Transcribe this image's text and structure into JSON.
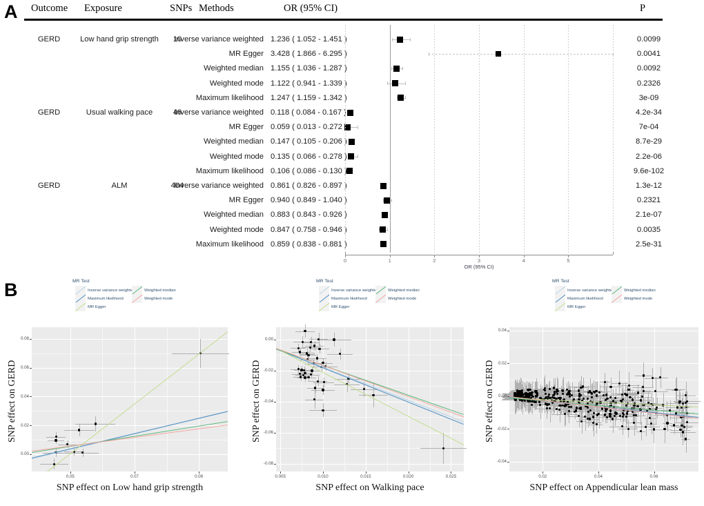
{
  "panels": {
    "a_letter": "A",
    "b_letter": "B"
  },
  "table": {
    "headers": {
      "outcome": "Outcome",
      "exposure": "Exposure",
      "snps": "SNPs",
      "methods": "Methods",
      "or": "OR (95% CI)",
      "p": "P"
    },
    "groups": [
      {
        "outcome": "GERD",
        "exposure": "Low hand grip strength",
        "snps": "10",
        "rows": [
          {
            "method": "Inverse variance weighted",
            "or_text": "1.236 ( 1.052 - 1.451 )",
            "est": 1.236,
            "lo": 1.052,
            "hi": 1.451,
            "p": "0.0099"
          },
          {
            "method": "MR Egger",
            "or_text": "3.428 ( 1.866 - 6.295 )",
            "est": 3.428,
            "lo": 1.866,
            "hi": 6.295,
            "p": "0.0041"
          },
          {
            "method": "Weighted median",
            "or_text": "1.155 ( 1.036 - 1.287 )",
            "est": 1.155,
            "lo": 1.036,
            "hi": 1.287,
            "p": "0.0092"
          },
          {
            "method": "Weighted mode",
            "or_text": "1.122 ( 0.941 - 1.339 )",
            "est": 1.122,
            "lo": 0.941,
            "hi": 1.339,
            "p": "0.2326"
          },
          {
            "method": "Maximum likelihood",
            "or_text": "1.247 ( 1.159 - 1.342 )",
            "est": 1.247,
            "lo": 1.159,
            "hi": 1.342,
            "p": "3e-09"
          }
        ]
      },
      {
        "outcome": "GERD",
        "exposure": "Usual walking pace",
        "snps": "46",
        "rows": [
          {
            "method": "Inverse variance weighted",
            "or_text": "0.118 ( 0.084 - 0.167 )",
            "est": 0.118,
            "lo": 0.084,
            "hi": 0.167,
            "p": "4.2e-34"
          },
          {
            "method": "MR Egger",
            "or_text": "0.059 ( 0.013 - 0.272 )",
            "est": 0.059,
            "lo": 0.013,
            "hi": 0.272,
            "p": "7e-04"
          },
          {
            "method": "Weighted median",
            "or_text": "0.147 ( 0.105 - 0.206 )",
            "est": 0.147,
            "lo": 0.105,
            "hi": 0.206,
            "p": "8.7e-29"
          },
          {
            "method": "Weighted mode",
            "or_text": "0.135 ( 0.066 - 0.278 )",
            "est": 0.135,
            "lo": 0.066,
            "hi": 0.278,
            "p": "2.2e-06"
          },
          {
            "method": "Maximum likelihood",
            "or_text": "0.106 ( 0.086 - 0.130 )",
            "est": 0.106,
            "lo": 0.086,
            "hi": 0.13,
            "p": "9.6e-102"
          }
        ]
      },
      {
        "outcome": "GERD",
        "exposure": "ALM",
        "snps": "404",
        "rows": [
          {
            "method": "Inverse variance weighted",
            "or_text": "0.861 ( 0.826 - 0.897 )",
            "est": 0.861,
            "lo": 0.826,
            "hi": 0.897,
            "p": "1.3e-12"
          },
          {
            "method": "MR Egger",
            "or_text": "0.940 ( 0.849 - 1.040 )",
            "est": 0.94,
            "lo": 0.849,
            "hi": 1.04,
            "p": "0.2321"
          },
          {
            "method": "Weighted median",
            "or_text": "0.883 ( 0.843 - 0.926 )",
            "est": 0.883,
            "lo": 0.843,
            "hi": 0.926,
            "p": "2.1e-07"
          },
          {
            "method": "Weighted mode",
            "or_text": "0.847 ( 0.758 - 0.946 )",
            "est": 0.847,
            "lo": 0.758,
            "hi": 0.946,
            "p": "0.0035"
          },
          {
            "method": "Maximum likelihood",
            "or_text": "0.859 ( 0.838 - 0.881 )",
            "est": 0.859,
            "lo": 0.838,
            "hi": 0.881,
            "p": "2.5e-31"
          }
        ]
      }
    ]
  },
  "forest": {
    "axis_title": "OR (95% CI)",
    "ticks": [
      "0",
      "1",
      "2",
      "3",
      "4",
      "5"
    ],
    "tick_values": [
      0,
      1,
      2,
      3,
      4,
      5
    ],
    "xmin": 0,
    "xmax": 6,
    "reference": 1
  },
  "legend": {
    "title": "MR Test",
    "items": [
      {
        "label": "Inverse variance weighted",
        "color": "#b9d4e8"
      },
      {
        "label": "Maximum likelihood",
        "color": "#4f8fc0"
      },
      {
        "label": "MR Egger",
        "color": "#c3dd8e"
      },
      {
        "label": "Weighted median",
        "color": "#5bb87e"
      },
      {
        "label": "Weighted mode",
        "color": "#f2a6a0"
      }
    ]
  },
  "chart_data": [
    {
      "type": "scatter",
      "title": "",
      "xlabel": "SNP effect on Low hand grip strength",
      "ylabel": "SNP effect on GERD",
      "xlim": [
        0.038,
        0.099
      ],
      "ylim": [
        -0.012,
        0.088
      ],
      "xticks": [
        0.05,
        0.07,
        0.09
      ],
      "xtick_labels": [
        "0.05",
        "0.07",
        "0.09"
      ],
      "yticks": [
        0.0,
        0.02,
        0.04,
        0.06,
        0.08
      ],
      "ytick_labels": [
        "0.00",
        "0.02",
        "0.04",
        "0.06",
        "0.08"
      ],
      "grid": true,
      "points": [
        {
          "x": 0.0905,
          "y": 0.07,
          "xerr": 0.009,
          "yerr": 0.01
        },
        {
          "x": 0.0578,
          "y": 0.021,
          "xerr": 0.0062,
          "yerr": 0.0052
        },
        {
          "x": 0.0528,
          "y": 0.0167,
          "xerr": 0.0048,
          "yerr": 0.0045
        },
        {
          "x": 0.0456,
          "y": 0.012,
          "xerr": 0.003,
          "yerr": 0.0032
        },
        {
          "x": 0.0455,
          "y": 0.0095,
          "xerr": 0.0026,
          "yerr": 0.0026
        },
        {
          "x": 0.0491,
          "y": 0.0068,
          "xerr": 0.003,
          "yerr": 0.0026
        },
        {
          "x": 0.0512,
          "y": 0.0018,
          "xerr": 0.0032,
          "yerr": 0.003
        },
        {
          "x": 0.0455,
          "y": 0.001,
          "xerr": 0.004,
          "yerr": 0.0028
        },
        {
          "x": 0.0538,
          "y": 0.001,
          "xerr": 0.005,
          "yerr": 0.003
        },
        {
          "x": 0.0449,
          "y": -0.0068,
          "xerr": 0.0044,
          "yerr": 0.004
        }
      ],
      "lines": [
        {
          "name": "Inverse variance weighted",
          "color": "#b9d4e8",
          "intercept": -0.0234,
          "slope": 0.536
        },
        {
          "name": "Maximum likelihood",
          "color": "#4f8fc0",
          "intercept": -0.0228,
          "slope": 0.53
        },
        {
          "name": "MR Egger",
          "color": "#c3dd8e",
          "intercept": -0.0855,
          "slope": 1.726
        },
        {
          "name": "Weighted median",
          "color": "#5bb87e",
          "intercept": -0.0121,
          "slope": 0.352
        },
        {
          "name": "Weighted mode",
          "color": "#f2a6a0",
          "intercept": -0.009,
          "slope": 0.297
        }
      ]
    },
    {
      "type": "scatter",
      "title": "",
      "xlabel": "SNP effect on Walking pace",
      "ylabel": "SNP effect on GERD",
      "xlim": [
        0.0045,
        0.0265
      ],
      "ylim": [
        -0.085,
        0.008
      ],
      "xticks": [
        0.005,
        0.01,
        0.015,
        0.02,
        0.025
      ],
      "xtick_labels": [
        "0.005",
        "0.010",
        "0.015",
        "0.020",
        "0.025"
      ],
      "yticks": [
        -0.08,
        -0.06,
        -0.04,
        -0.02,
        0.0
      ],
      "ytick_labels": [
        "-0.08",
        "-0.06",
        "-0.04",
        "-0.02",
        "0.00"
      ],
      "grid": true,
      "points": [
        {
          "x": 0.0079,
          "y": 0.0055,
          "xerr": 0.0011,
          "yerr": 0.0044
        },
        {
          "x": 0.0095,
          "y": 0.0003,
          "xerr": 0.0011,
          "yerr": 0.004
        },
        {
          "x": 0.0113,
          "y": 0.0,
          "xerr": 0.002,
          "yerr": 0.0044
        },
        {
          "x": 0.0076,
          "y": -0.0014,
          "xerr": 0.0011,
          "yerr": 0.0036
        },
        {
          "x": 0.0086,
          "y": -0.0016,
          "xerr": 0.001,
          "yerr": 0.0032
        },
        {
          "x": 0.009,
          "y": -0.004,
          "xerr": 0.0011,
          "yerr": 0.003
        },
        {
          "x": 0.0071,
          "y": -0.0055,
          "xerr": 0.0009,
          "yerr": 0.0028
        },
        {
          "x": 0.0085,
          "y": -0.005,
          "xerr": 0.001,
          "yerr": 0.003
        },
        {
          "x": 0.0096,
          "y": -0.006,
          "xerr": 0.0011,
          "yerr": 0.003
        },
        {
          "x": 0.0073,
          "y": -0.008,
          "xerr": 0.0009,
          "yerr": 0.0028
        },
        {
          "x": 0.0081,
          "y": -0.0086,
          "xerr": 0.0009,
          "yerr": 0.0026
        },
        {
          "x": 0.0081,
          "y": -0.0092,
          "xerr": 0.0009,
          "yerr": 0.0026
        },
        {
          "x": 0.012,
          "y": -0.0092,
          "xerr": 0.0015,
          "yerr": 0.0036
        },
        {
          "x": 0.0083,
          "y": -0.01,
          "xerr": 0.0009,
          "yerr": 0.0026
        },
        {
          "x": 0.0093,
          "y": -0.012,
          "xerr": 0.0011,
          "yerr": 0.0028
        },
        {
          "x": 0.0082,
          "y": -0.0128,
          "xerr": 0.0009,
          "yerr": 0.0026
        },
        {
          "x": 0.01,
          "y": -0.015,
          "xerr": 0.0011,
          "yerr": 0.0028
        },
        {
          "x": 0.0089,
          "y": -0.0155,
          "xerr": 0.001,
          "yerr": 0.0026
        },
        {
          "x": 0.0098,
          "y": -0.0175,
          "xerr": 0.0011,
          "yerr": 0.003
        },
        {
          "x": 0.0103,
          "y": -0.0172,
          "xerr": 0.0014,
          "yerr": 0.003
        },
        {
          "x": 0.0071,
          "y": -0.019,
          "xerr": 0.0009,
          "yerr": 0.0026
        },
        {
          "x": 0.0075,
          "y": -0.0196,
          "xerr": 0.0009,
          "yerr": 0.0026
        },
        {
          "x": 0.0078,
          "y": -0.0198,
          "xerr": 0.0009,
          "yerr": 0.0026
        },
        {
          "x": 0.0087,
          "y": -0.02,
          "xerr": 0.001,
          "yerr": 0.0026
        },
        {
          "x": 0.0079,
          "y": -0.0215,
          "xerr": 0.0009,
          "yerr": 0.0026
        },
        {
          "x": 0.0073,
          "y": -0.0222,
          "xerr": 0.0009,
          "yerr": 0.0026
        },
        {
          "x": 0.0077,
          "y": -0.0228,
          "xerr": 0.0009,
          "yerr": 0.0026
        },
        {
          "x": 0.0086,
          "y": -0.0225,
          "xerr": 0.001,
          "yerr": 0.0026
        },
        {
          "x": 0.0074,
          "y": -0.024,
          "xerr": 0.0009,
          "yerr": 0.0026
        },
        {
          "x": 0.0079,
          "y": -0.0245,
          "xerr": 0.0009,
          "yerr": 0.0026
        },
        {
          "x": 0.0083,
          "y": -0.0243,
          "xerr": 0.0009,
          "yerr": 0.0026
        },
        {
          "x": 0.013,
          "y": -0.0252,
          "xerr": 0.0016,
          "yerr": 0.0034
        },
        {
          "x": 0.0094,
          "y": -0.0268,
          "xerr": 0.0011,
          "yerr": 0.003
        },
        {
          "x": 0.0101,
          "y": -0.0275,
          "xerr": 0.0012,
          "yerr": 0.003
        },
        {
          "x": 0.0128,
          "y": -0.0288,
          "xerr": 0.0015,
          "yerr": 0.005
        },
        {
          "x": 0.0148,
          "y": -0.032,
          "xerr": 0.0016,
          "yerr": 0.005
        },
        {
          "x": 0.0091,
          "y": -0.0312,
          "xerr": 0.001,
          "yerr": 0.003
        },
        {
          "x": 0.01,
          "y": -0.0325,
          "xerr": 0.0014,
          "yerr": 0.0032
        },
        {
          "x": 0.0159,
          "y": -0.0358,
          "xerr": 0.0017,
          "yerr": 0.008
        },
        {
          "x": 0.009,
          "y": -0.0385,
          "xerr": 0.0011,
          "yerr": 0.006
        },
        {
          "x": 0.01,
          "y": -0.0455,
          "xerr": 0.0016,
          "yerr": 0.0044
        },
        {
          "x": 0.0241,
          "y": -0.07,
          "xerr": 0.0027,
          "yerr": 0.01
        }
      ],
      "lines": [
        {
          "name": "Inverse variance weighted",
          "color": "#b9d4e8",
          "intercept": 0.0038,
          "slope": -2.136
        },
        {
          "name": "Maximum likelihood",
          "color": "#4f8fc0",
          "intercept": 0.0041,
          "slope": -2.21
        },
        {
          "name": "MR Egger",
          "color": "#c3dd8e",
          "intercept": 0.0075,
          "slope": -2.83
        },
        {
          "name": "Weighted median",
          "color": "#5bb87e",
          "intercept": 0.0028,
          "slope": -1.924
        },
        {
          "name": "Weighted mode",
          "color": "#f2a6a0",
          "intercept": 0.0036,
          "slope": -2.01
        }
      ]
    },
    {
      "type": "scatter",
      "title": "",
      "xlabel": "SNP effect on Appendicular lean mass",
      "ylabel": "SNP effect on GERD",
      "xlim": [
        0.008,
        0.076
      ],
      "ylim": [
        -0.046,
        0.042
      ],
      "xticks": [
        0.02,
        0.04,
        0.06
      ],
      "xtick_labels": [
        "0.02",
        "0.04",
        "0.06"
      ],
      "yticks": [
        -0.04,
        -0.02,
        0.0,
        0.02,
        0.04
      ],
      "ytick_labels": [
        "-0.04",
        "-0.02",
        "0.00",
        "0.02",
        "0.04"
      ],
      "grid": true,
      "n_points": 404,
      "points_note": "dense cloud concentrated at x 0.010-0.035, y -0.025 to 0.020",
      "lines": [
        {
          "name": "Inverse variance weighted",
          "color": "#b9d4e8",
          "intercept": 0.0007,
          "slope": -0.178
        },
        {
          "name": "Maximum likelihood",
          "color": "#4f8fc0",
          "intercept": 0.0008,
          "slope": -0.18
        },
        {
          "name": "MR Egger",
          "color": "#c3dd8e",
          "intercept": -0.0003,
          "slope": -0.081
        },
        {
          "name": "Weighted median",
          "color": "#5bb87e",
          "intercept": 0.0004,
          "slope": -0.143
        },
        {
          "name": "Weighted mode",
          "color": "#f2a6a0",
          "intercept": 0.0013,
          "slope": -0.196
        }
      ]
    }
  ]
}
